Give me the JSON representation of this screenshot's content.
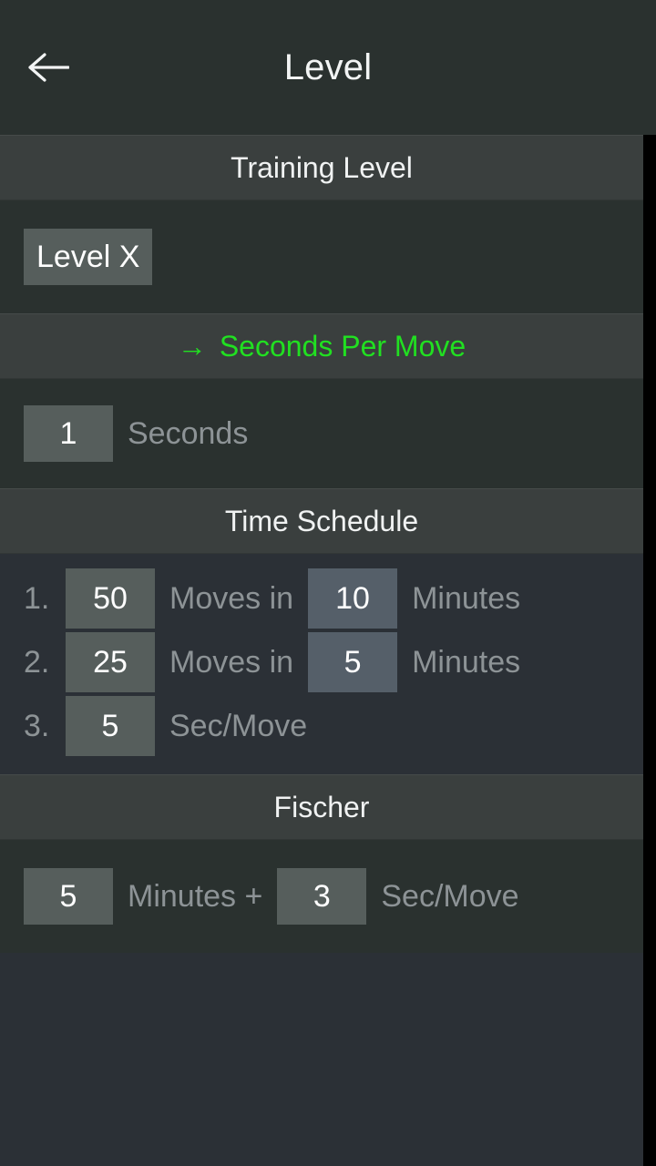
{
  "appbar": {
    "back_icon": "arrow-left-icon",
    "title": "Level"
  },
  "sections": {
    "training_level": {
      "header": "Training Level",
      "level_button": "Level X"
    },
    "seconds_per_move": {
      "arrow_glyph": "→",
      "header": "Seconds Per Move",
      "value": "1",
      "unit_label": "Seconds",
      "accent_color": "#21e021"
    },
    "time_schedule": {
      "header": "Time Schedule",
      "rows": [
        {
          "index": "1.",
          "moves": "50",
          "moves_label": "Moves in",
          "time": "10",
          "time_label": "Minutes"
        },
        {
          "index": "2.",
          "moves": "25",
          "moves_label": "Moves in",
          "time": "5",
          "time_label": "Minutes"
        },
        {
          "index": "3.",
          "moves": "5",
          "moves_label": "Sec/Move",
          "time": "",
          "time_label": ""
        }
      ]
    },
    "fischer": {
      "header": "Fischer",
      "minutes": "5",
      "minutes_label": "Minutes +",
      "increment": "3",
      "increment_label": "Sec/Move"
    }
  },
  "colors": {
    "background": "#2b3036",
    "appbar": "#2a312f",
    "section_header": "#3a3f3e",
    "chip": "#565e5c",
    "chip_alt": "#555f69",
    "accent_green": "#21e021",
    "label_gray": "#8d9396",
    "text_white": "#f2f4f4"
  }
}
